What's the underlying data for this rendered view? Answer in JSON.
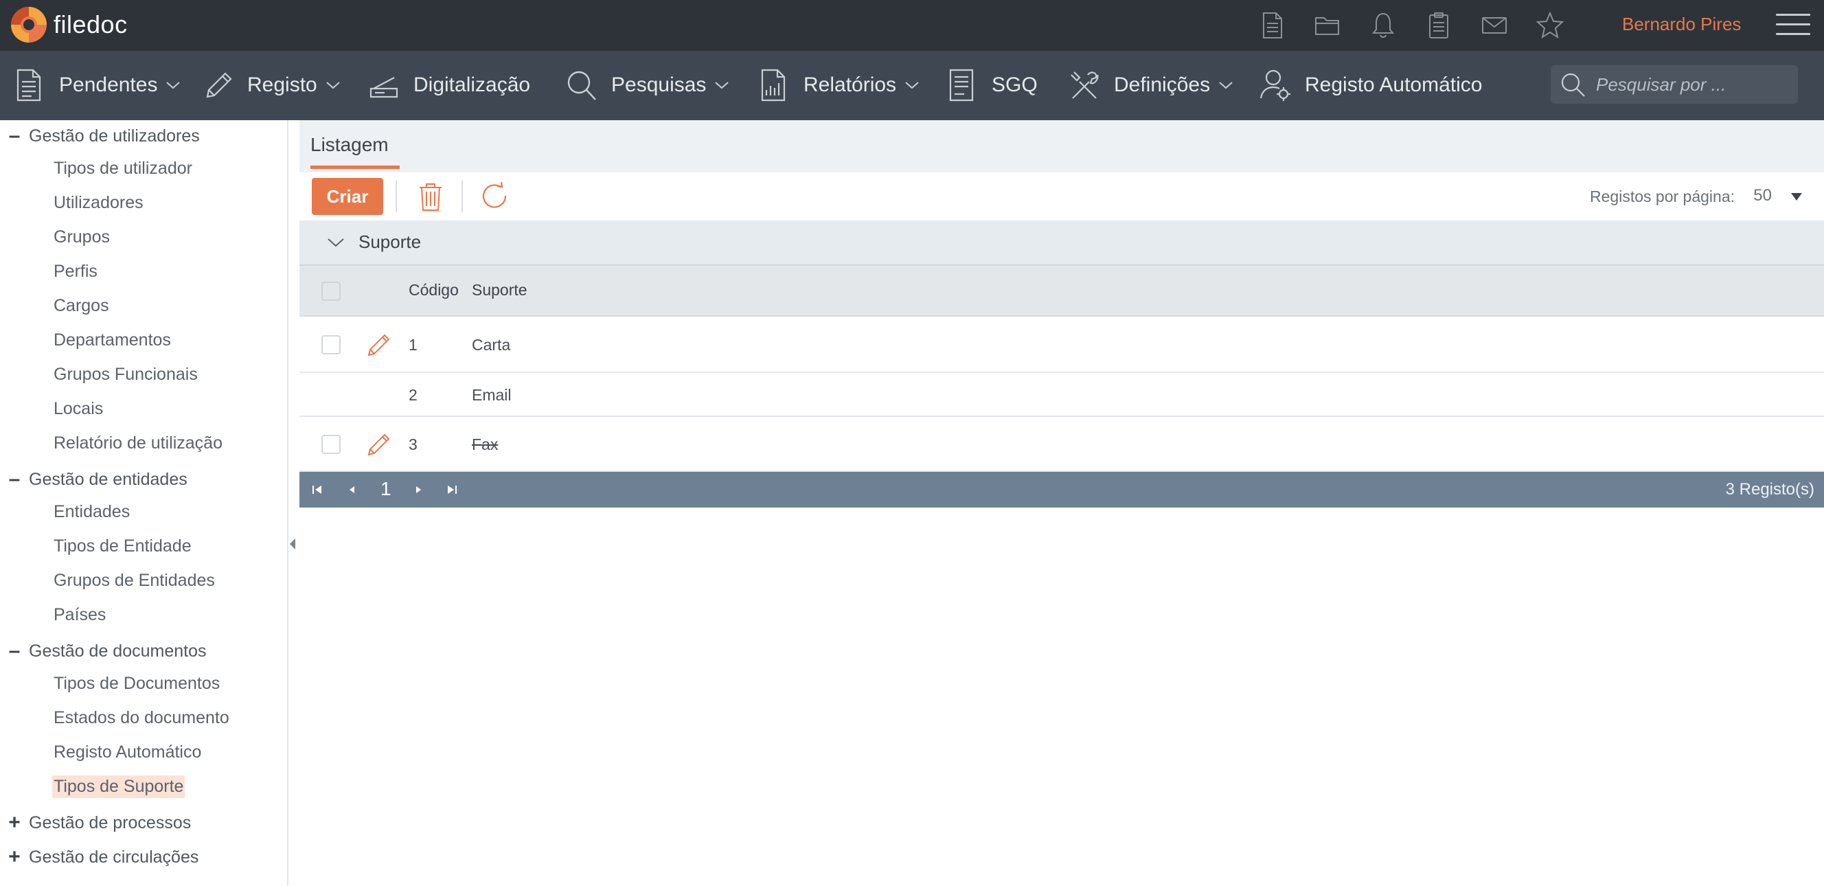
{
  "app": {
    "name": "filedoc",
    "user": "Bernardo Pires"
  },
  "top_icons": [
    "document-icon",
    "folder-icon",
    "bell-icon",
    "clipboard-icon",
    "mail-icon",
    "star-icon"
  ],
  "nav": {
    "items": [
      {
        "label": "Pendentes",
        "icon": "document-icon",
        "dropdown": true
      },
      {
        "label": "Registo",
        "icon": "pencil-icon",
        "dropdown": true
      },
      {
        "label": "Digitalização",
        "icon": "scanner-icon",
        "dropdown": false
      },
      {
        "label": "Pesquisas",
        "icon": "search-icon",
        "dropdown": true
      },
      {
        "label": "Relatórios",
        "icon": "report-icon",
        "dropdown": true
      },
      {
        "label": "SGQ",
        "icon": "list-document-icon",
        "dropdown": false
      },
      {
        "label": "Definições",
        "icon": "tools-icon",
        "dropdown": true
      },
      {
        "label": "Registo Automático",
        "icon": "user-gear-icon",
        "dropdown": false
      }
    ],
    "search_placeholder": "Pesquisar por ..."
  },
  "sidebar": {
    "groups": [
      {
        "label": "Gestão de utilizadores",
        "toggle": "–",
        "items": [
          "Tipos de utilizador",
          "Utilizadores",
          "Grupos",
          "Perfis",
          "Cargos",
          "Departamentos",
          "Grupos Funcionais",
          "Locais",
          "Relatório de utilização"
        ]
      },
      {
        "label": "Gestão de entidades",
        "toggle": "–",
        "items": [
          "Entidades",
          "Tipos de Entidade",
          "Grupos de Entidades",
          "Países"
        ]
      },
      {
        "label": "Gestão de documentos",
        "toggle": "–",
        "items": [
          "Tipos de Documentos",
          "Estados do documento",
          "Registo Automático",
          "Tipos de Suporte"
        ]
      },
      {
        "label": "Gestão de processos",
        "toggle": "+",
        "items": []
      },
      {
        "label": "Gestão de circulações",
        "toggle": "+",
        "items": []
      }
    ],
    "active_item": "Tipos de Suporte"
  },
  "content": {
    "tab": "Listagem",
    "toolbar": {
      "create_label": "Criar",
      "per_page_label": "Registos por página:",
      "per_page_value": "50"
    },
    "group_header": "Suporte",
    "columns": {
      "code": "Código",
      "support": "Suporte"
    },
    "rows": [
      {
        "code": "1",
        "support": "Carta",
        "editable": true,
        "strike": false
      },
      {
        "code": "2",
        "support": "Email",
        "editable": false,
        "strike": false
      },
      {
        "code": "3",
        "support": "Fax",
        "editable": true,
        "strike": true
      }
    ],
    "pager": {
      "page": "1",
      "count": "3 Registo(s)"
    }
  },
  "colors": {
    "accent": "#e8784a",
    "topbar": "#2e333a",
    "nav": "#3f4852",
    "pager": "#6e8194"
  }
}
